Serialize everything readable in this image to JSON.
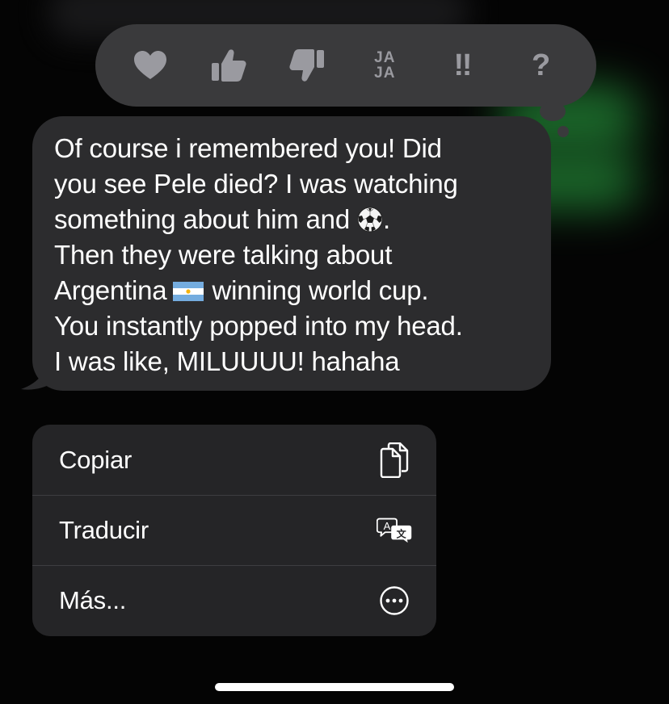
{
  "tapbacks": [
    {
      "name": "heart-reaction",
      "icon": "heart-icon"
    },
    {
      "name": "thumbs-up-reaction",
      "icon": "thumbs-up-icon"
    },
    {
      "name": "thumbs-down-reaction",
      "icon": "thumbs-down-icon"
    },
    {
      "name": "haha-reaction",
      "label_top": "JA",
      "label_bottom": "JA"
    },
    {
      "name": "emphasis-reaction",
      "label": "‼"
    },
    {
      "name": "question-reaction",
      "label": "?"
    }
  ],
  "message": {
    "line1": "Of course i remembered you! Did",
    "line2": "you see Pele died? I was watching",
    "line3_before": "something about him and",
    "line3_after": ".",
    "emoji_soccer": "soccer-ball-emoji",
    "line4": "Then they were talking about",
    "line5_before": "Argentina",
    "line5_after": "winning world cup.",
    "emoji_flag": "argentina-flag-emoji",
    "line6": "You instantly popped into my head.",
    "line7": "I was like, MILUUUU! hahaha"
  },
  "menu": {
    "items": [
      {
        "label": "Copiar",
        "icon": "copy-icon"
      },
      {
        "label": "Traducir",
        "icon": "translate-icon"
      },
      {
        "label": "Más...",
        "icon": "more-icon"
      }
    ]
  },
  "colors": {
    "background": "#040404",
    "bubble": "#2c2c2e",
    "tapback_bar": "#3a3a3c",
    "menu": "#252527",
    "icon_gray": "#9a9aa0",
    "text": "#ffffff"
  }
}
